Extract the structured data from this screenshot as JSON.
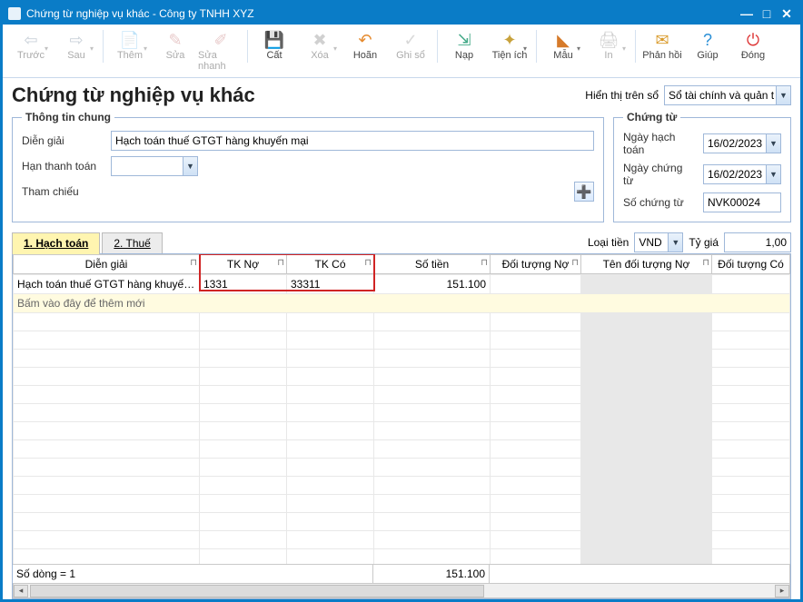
{
  "title": "Chứng từ nghiệp vụ khác - Công ty TNHH XYZ",
  "toolbar": {
    "prev": "Trước",
    "next": "Sau",
    "add": "Thêm",
    "edit": "Sửa",
    "quickedit": "Sửa nhanh",
    "cut": "Cất",
    "delete": "Xóa",
    "undo": "Hoãn",
    "post": "Ghi sổ",
    "load": "Nạp",
    "utils": "Tiện ích",
    "template": "Mẫu",
    "print": "In",
    "feedback": "Phản hồi",
    "help": "Giúp",
    "close": "Đóng"
  },
  "pageTitle": "Chứng từ nghiệp vụ khác",
  "displayLabel": "Hiển thị trên sổ",
  "displayValue": "Sổ tài chính và quản trị",
  "general": {
    "legend": "Thông tin chung",
    "descLabel": "Diễn giải",
    "descValue": "Hạch toán thuế GTGT hàng khuyến mại",
    "termLabel": "Hạn thanh toán",
    "termValue": "",
    "refLabel": "Tham chiếu"
  },
  "voucher": {
    "legend": "Chứng từ",
    "postDateLabel": "Ngày hạch toán",
    "postDate": "16/02/2023",
    "voucherDateLabel": "Ngày chứng từ",
    "voucherDate": "16/02/2023",
    "voucherNoLabel": "Số chứng từ",
    "voucherNo": "NVK00024"
  },
  "tabs": {
    "t1": "1. Hạch toán",
    "t2": "2. Thuế"
  },
  "currencyLabel": "Loại tiền",
  "currency": "VND",
  "rateLabel": "Tỷ giá",
  "rate": "1,00",
  "grid": {
    "cols": [
      "Diễn giải",
      "TK Nợ",
      "TK Có",
      "Số tiền",
      "Đối tượng Nợ",
      "Tên đối tượng Nợ",
      "Đối tượng Có"
    ],
    "rows": [
      {
        "desc": "Hạch toán thuế GTGT hàng khuyến mại",
        "debit": "1331",
        "credit": "33311",
        "amount": "151.100",
        "objDebit": "",
        "objDebitName": "",
        "objCredit": ""
      }
    ],
    "addRowText": "Bấm vào đây để thêm mới"
  },
  "footer": {
    "rowCountLabel": "Số dòng = 1",
    "totalAmount": "151.100"
  }
}
